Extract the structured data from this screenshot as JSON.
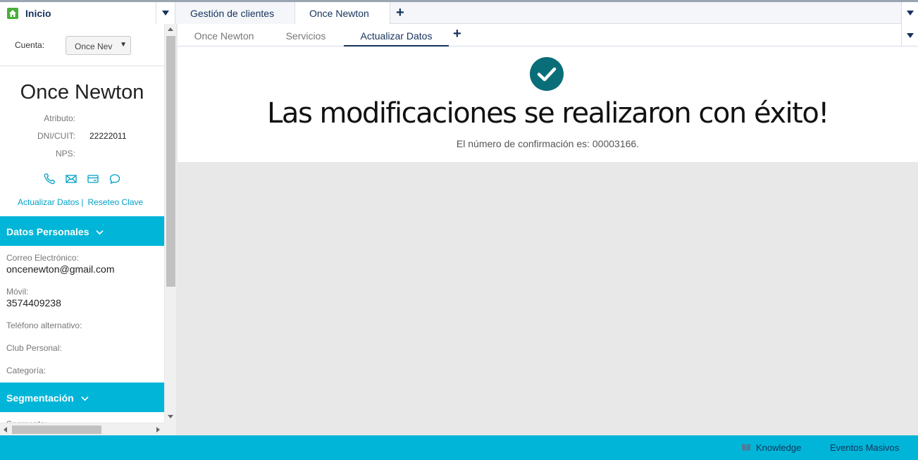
{
  "top_tabs": {
    "home_label": "Inicio",
    "tabs": [
      {
        "label": "Gestión de clientes"
      },
      {
        "label": "Once Newton"
      }
    ]
  },
  "sidebar": {
    "account_label": "Cuenta:",
    "account_value": "Once Nev",
    "customer_name": "Once Newton",
    "attributes": [
      {
        "label": "Atributo:",
        "value": ""
      },
      {
        "label": "DNI/CUIT:",
        "value": "22222011"
      },
      {
        "label": "NPS:",
        "value": ""
      }
    ],
    "links": {
      "update": "Actualizar Datos",
      "separator": "|",
      "reset": "Reseteo Clave"
    },
    "section_personal": "Datos Personales",
    "fields": [
      {
        "label": "Correo Electrónico:",
        "value": "oncenewton@gmail.com"
      },
      {
        "label": "Móvil:",
        "value": "3574409238"
      },
      {
        "label": "Teléfono alternativo:",
        "value": ""
      },
      {
        "label": "Club Personal:",
        "value": ""
      },
      {
        "label": "Categoría:",
        "value": ""
      }
    ],
    "section_segmentation": "Segmentación",
    "segment_label": "Segmento:"
  },
  "subtabs": [
    {
      "label": "Once Newton"
    },
    {
      "label": "Servicios"
    },
    {
      "label": "Actualizar Datos"
    }
  ],
  "success": {
    "title": "Las modificaciones se realizaron con éxito!",
    "confirmation": "El número de confirmación es: 00003166."
  },
  "footer": {
    "knowledge": "Knowledge",
    "events": "Eventos Masivos"
  },
  "colors": {
    "accent": "#00b5d8",
    "success_check": "#0a6e78",
    "link": "#00a0c6",
    "navy": "#16325c"
  }
}
